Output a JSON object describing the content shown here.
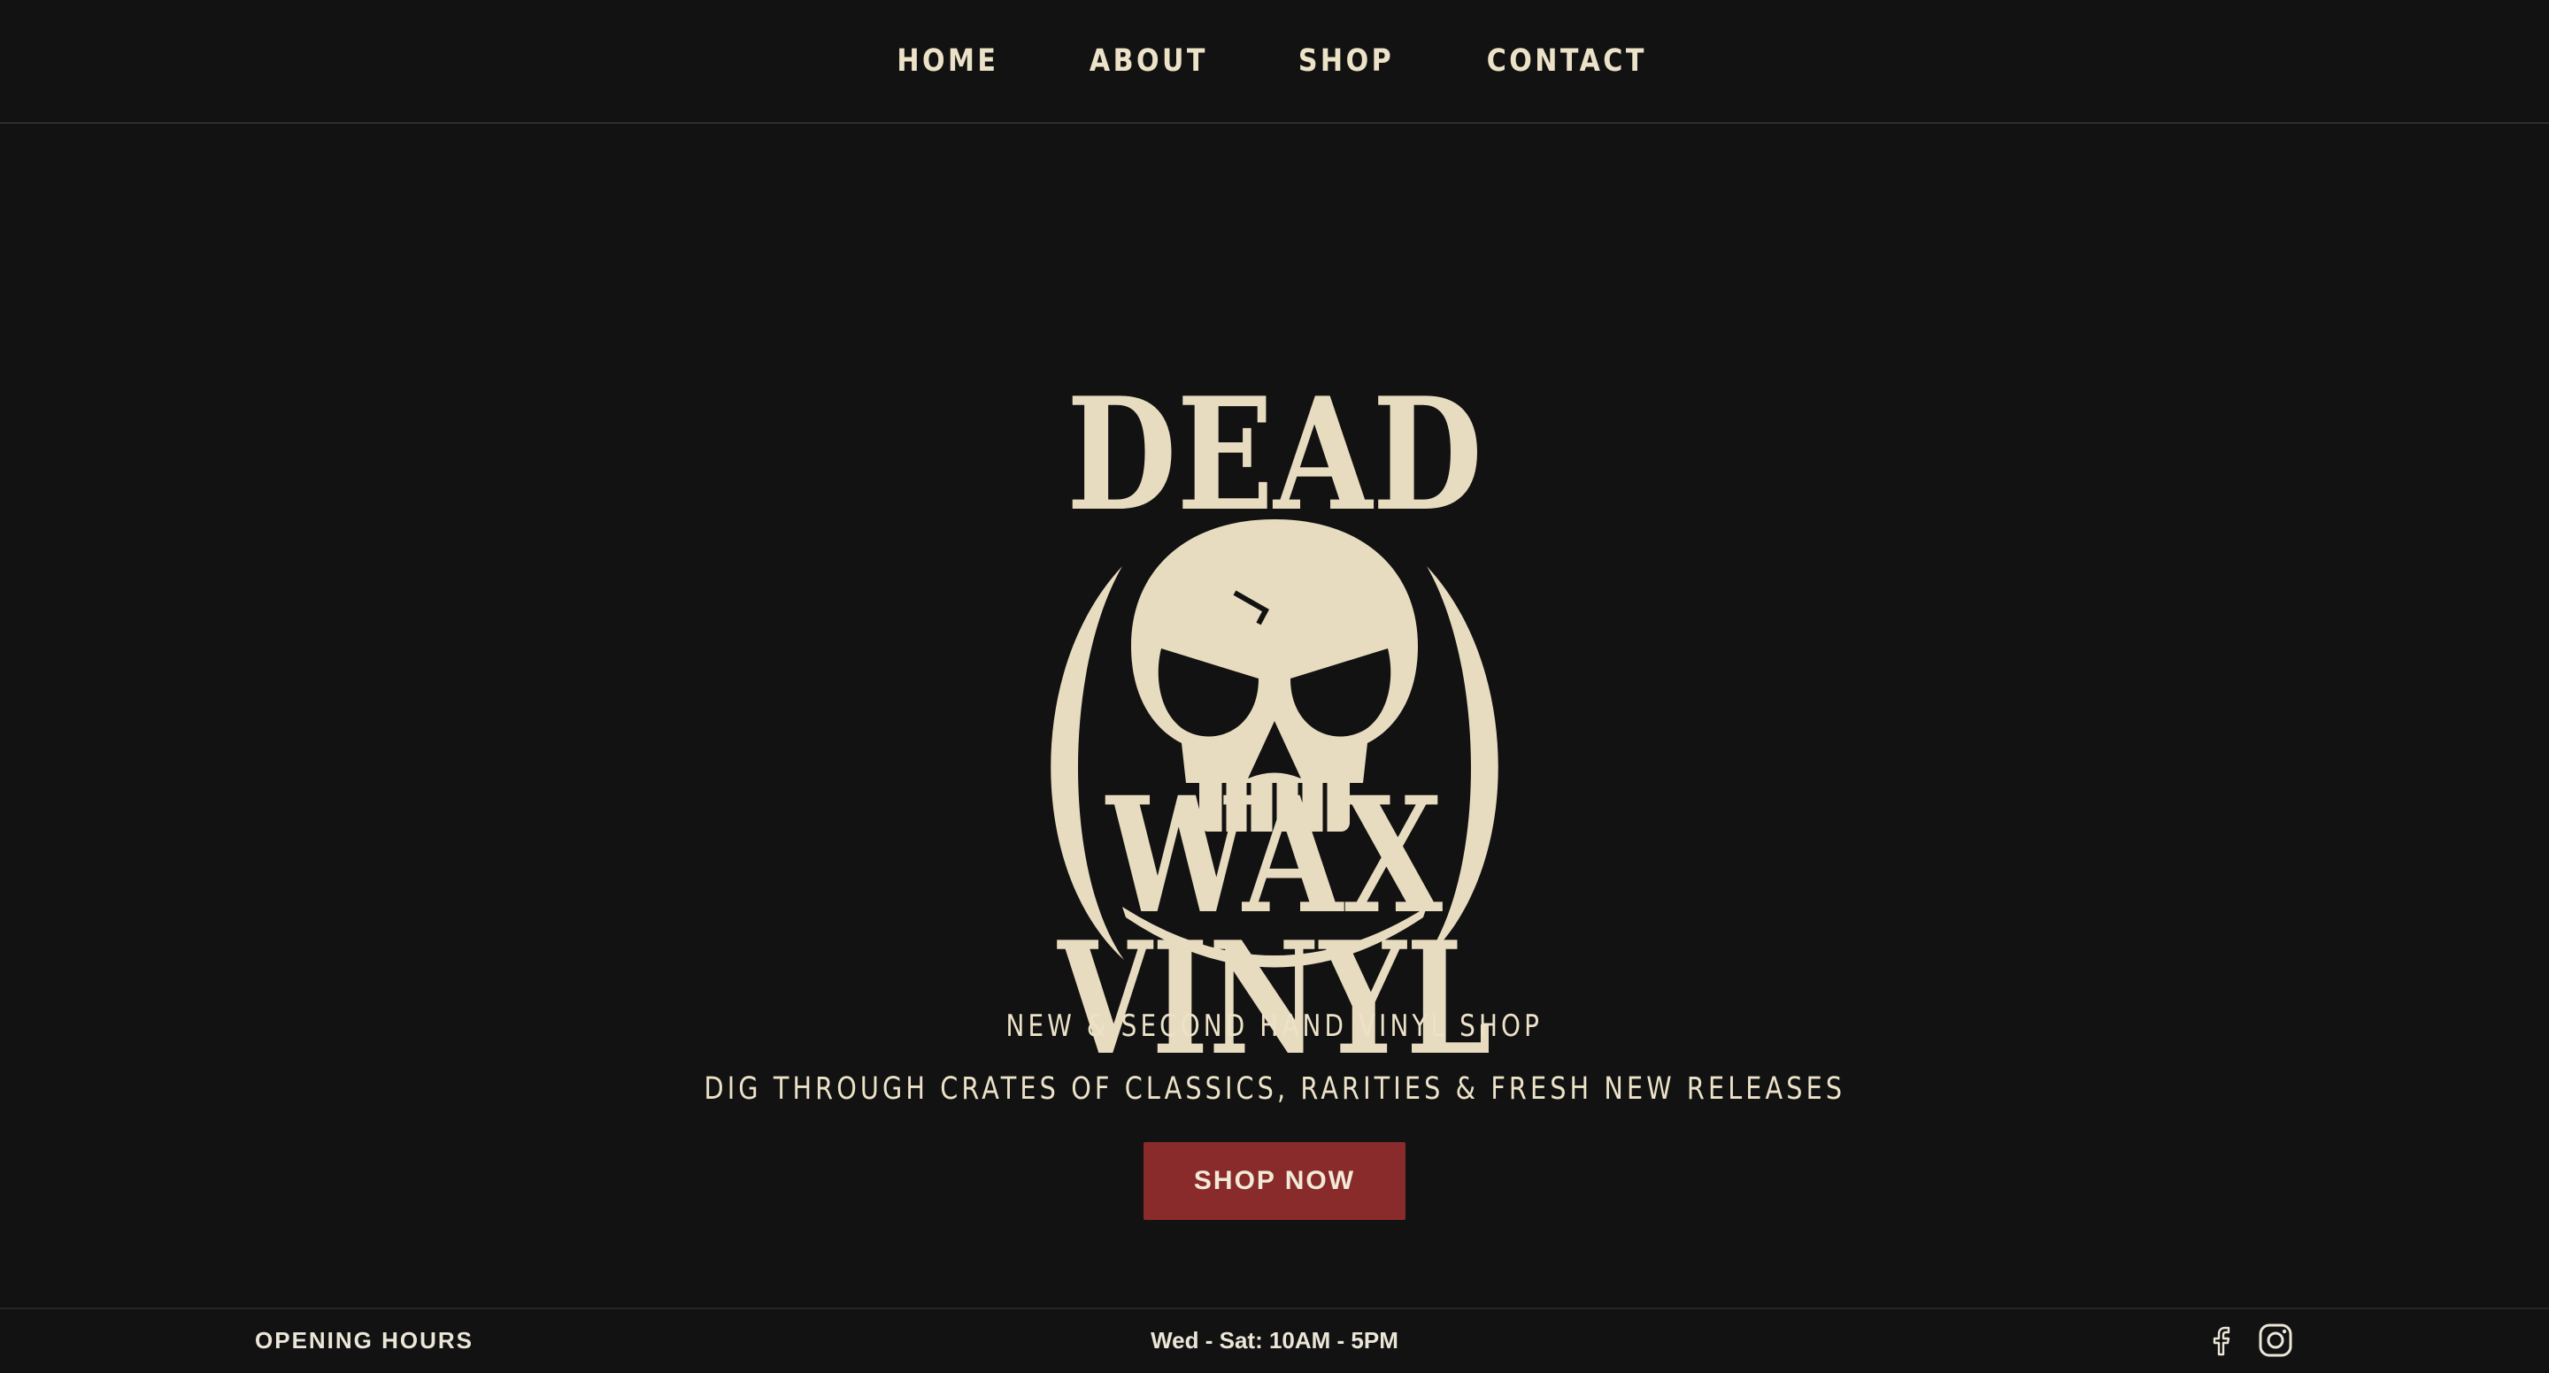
{
  "nav": {
    "items": [
      {
        "label": "HOME"
      },
      {
        "label": "ABOUT"
      },
      {
        "label": "SHOP"
      },
      {
        "label": "CONTACT"
      }
    ]
  },
  "hero": {
    "logo": {
      "word_top": "DEAD",
      "word_middle": "WAX",
      "word_bottom": "VINYL",
      "icon": "skull-icon"
    },
    "tagline_primary": "NEW & SECOND HAND VINYL SHOP",
    "tagline_secondary": "DIG THROUGH CRATES OF CLASSICS, RARITIES & FRESH NEW RELEASES",
    "cta_label": "SHOP NOW"
  },
  "footer": {
    "hours_label": "OPENING HOURS",
    "hours_value": "Wed - Sat: 10AM - 5PM",
    "social": [
      {
        "icon": "facebook-icon"
      },
      {
        "icon": "instagram-icon"
      }
    ]
  },
  "colors": {
    "background": "#121212",
    "cream": "#e8dcc0",
    "cta_red": "#8a2b2b",
    "divider": "#2e2e2e"
  }
}
